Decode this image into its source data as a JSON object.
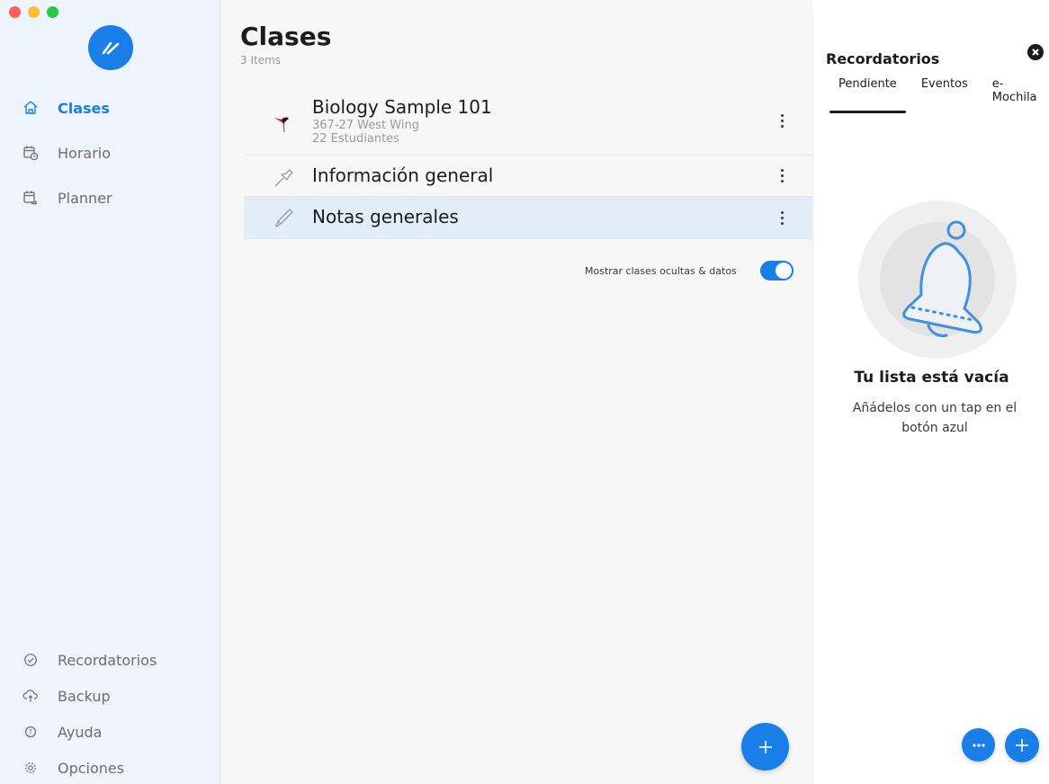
{
  "colors": {
    "accent": "#1a7ee8",
    "sidebar_bg": "#edf4fb",
    "selected_row": "#e1edf7"
  },
  "sidebar": {
    "top_items": [
      {
        "label": "Clases",
        "icon": "home-icon",
        "active": true
      },
      {
        "label": "Horario",
        "icon": "calendar-clock-icon",
        "active": false
      },
      {
        "label": "Planner",
        "icon": "calendar-planner-icon",
        "active": false
      }
    ],
    "bottom_items": [
      {
        "label": "Recordatorios",
        "icon": "check-circle-icon"
      },
      {
        "label": "Backup",
        "icon": "cloud-sync-icon"
      },
      {
        "label": "Ayuda",
        "icon": "help-icon"
      },
      {
        "label": "Opciones",
        "icon": "gear-icon"
      }
    ]
  },
  "main": {
    "title": "Clases",
    "subtitle": "3 Items",
    "items": [
      {
        "title": "Biology Sample 101",
        "line1": "367-27 West Wing",
        "line2": "22 Estudiantes",
        "icon": "hummingbird-icon"
      },
      {
        "title": "Información general",
        "icon": "pin-icon"
      },
      {
        "title": "Notas generales",
        "icon": "pencil-icon",
        "selected": true
      }
    ],
    "toggle": {
      "label": "Mostrar clases ocultas & datos",
      "on": true
    }
  },
  "reminders": {
    "title": "Recordatorios",
    "tabs": [
      "Pendiente",
      "Eventos",
      "e-Mochila"
    ],
    "active_tab": "Pendiente",
    "empty_title": "Tu lista está vacía",
    "empty_text": "Añádelos con un tap en el botón azul"
  }
}
